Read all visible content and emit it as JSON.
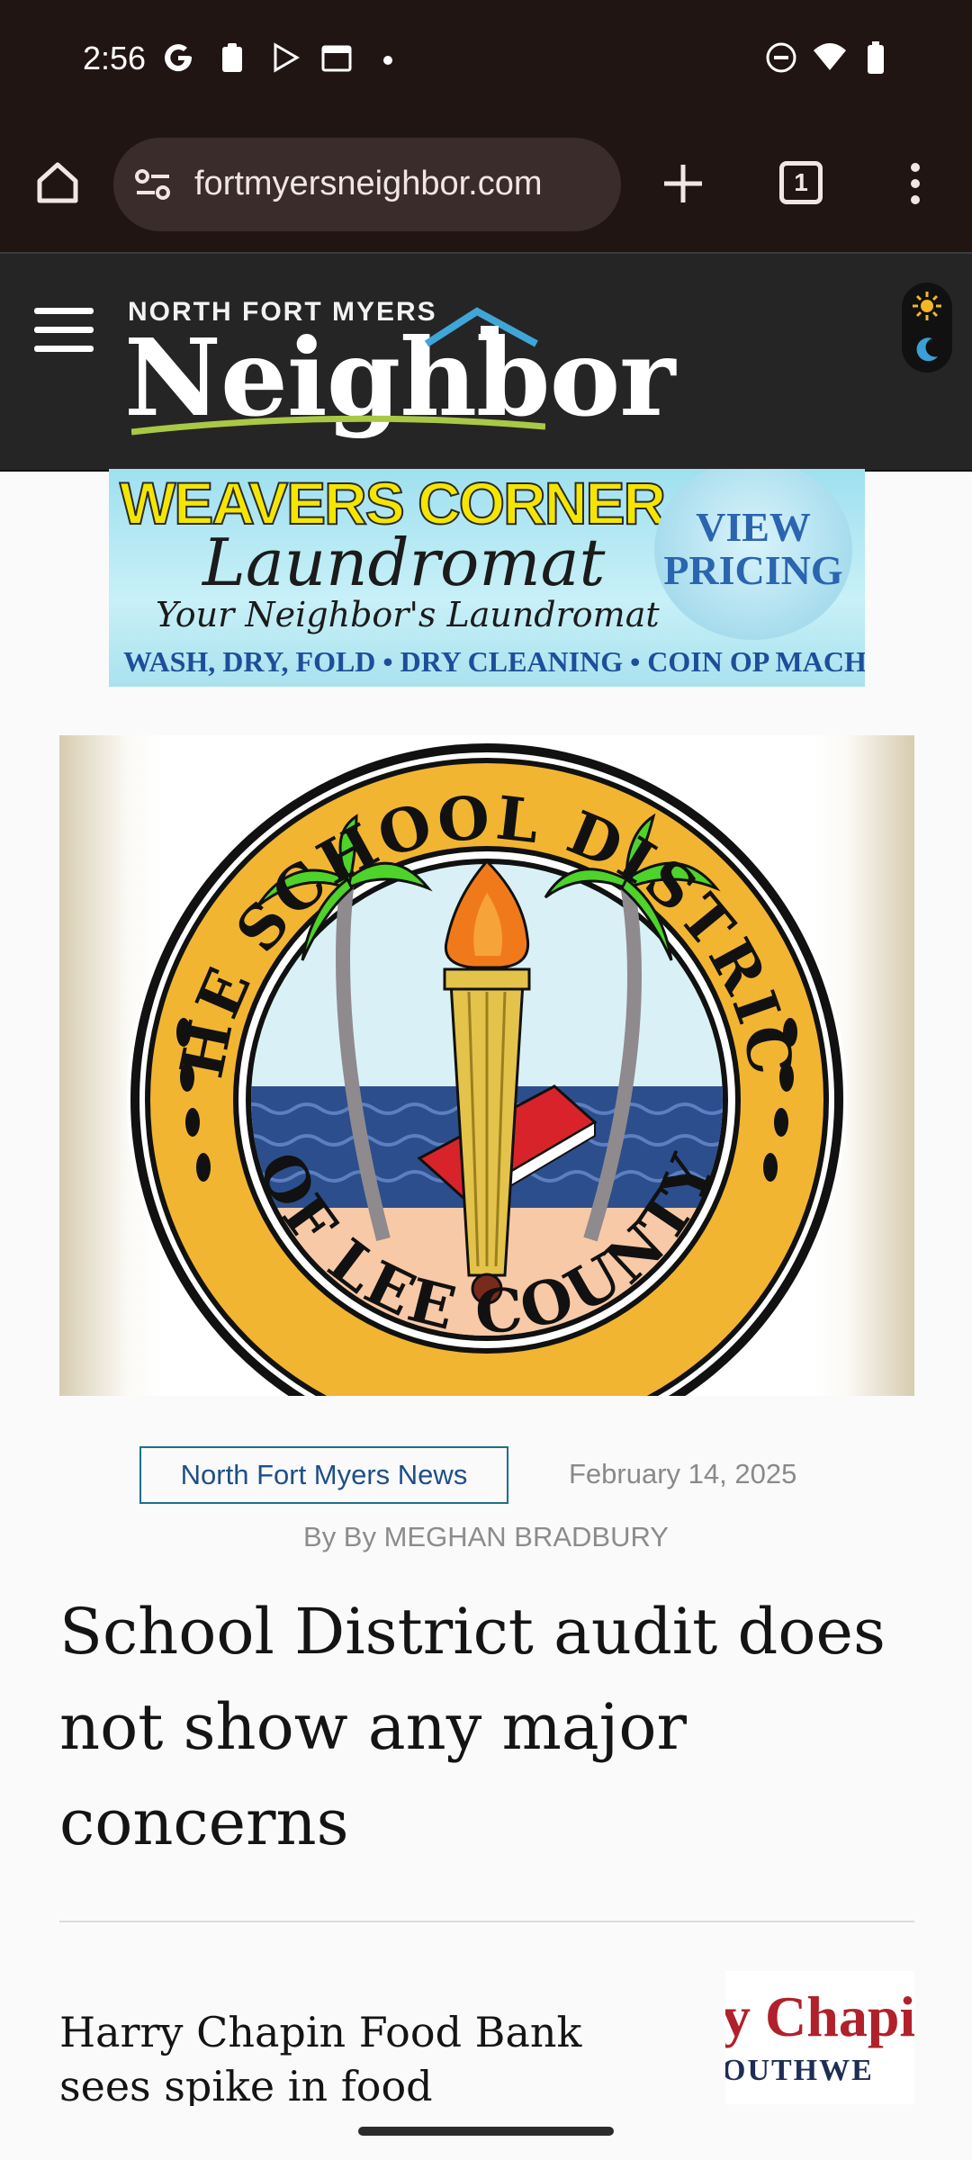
{
  "status_bar": {
    "time": "2:56",
    "left_icons": [
      "google-icon",
      "clipboard-icon",
      "play-store-icon",
      "calendar-icon",
      "dot-icon"
    ],
    "right_icons": [
      "dnd-icon",
      "wifi-icon",
      "battery-icon"
    ]
  },
  "browser": {
    "url": "fortmyersneighbor.com",
    "tab_count": "1"
  },
  "site": {
    "logo_top": "NORTH FORT MYERS",
    "logo_main": "Neighbor"
  },
  "ad": {
    "line1": "WEAVERS CORNER",
    "line2": "Laundromat",
    "line3": "Your Neighbor's Laundromat",
    "line4": "WASH, DRY, FOLD • DRY CLEANING • COIN OP MACHINES",
    "cta_line1": "VIEW",
    "cta_line2": "PRICING"
  },
  "featured_image": {
    "seal_top_text": "THE SCHOOL DISTRICT",
    "seal_bottom_text": "OF LEE COUNTY"
  },
  "article": {
    "category": "North Fort Myers News",
    "date": "February 14, 2025",
    "byline": "By By MEGHAN BRADBURY",
    "title": "School District audit does not show any major concerns"
  },
  "related": {
    "title": "Harry Chapin Food Bank sees spike in food distributions",
    "thumb_line1": "y Chapin",
    "thumb_line2": "OUTHWE"
  }
}
